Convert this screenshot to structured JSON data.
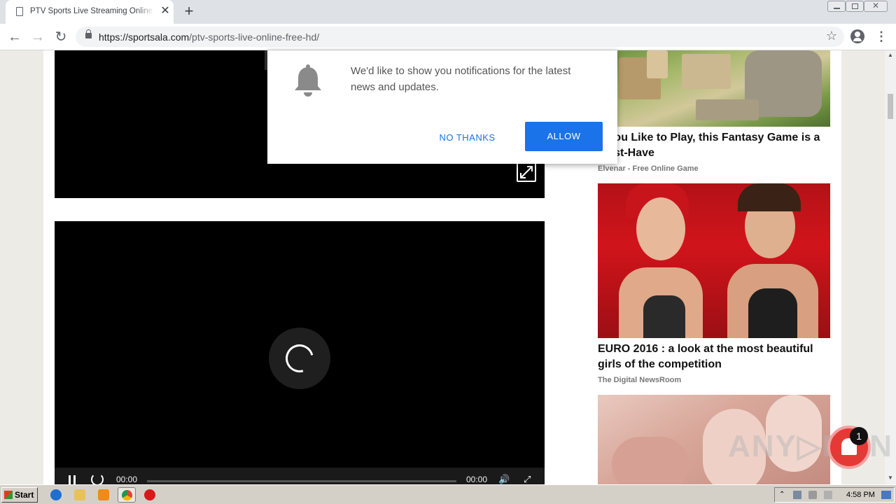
{
  "browser": {
    "tab_title": "PTV Sports Live Streaming Online *Free HD*",
    "url_host": "https://sportsala.com",
    "url_path": "/ptv-sports-live-online-free-hd/"
  },
  "notification_prompt": {
    "message": "We'd like to show you notifications for the latest news and updates.",
    "no_thanks_label": "NO THANKS",
    "allow_label": "ALLOW"
  },
  "player": {
    "time_current": "00:00",
    "time_total": "00:00"
  },
  "ads": [
    {
      "title": "If You Like to Play, this Fantasy Game is a Must-Have",
      "source": "Elvenar - Free Online Game"
    },
    {
      "title": "EURO 2016 : a look at the most beautiful girls of the competition",
      "source": "The Digital NewsRoom"
    }
  ],
  "watermark": {
    "text": "ANY.RUN",
    "badge_count": "1"
  },
  "taskbar": {
    "start_label": "Start",
    "clock": "4:58 PM"
  },
  "colors": {
    "accent": "#1a73e8",
    "page_bg": "#ecebe6",
    "taskbar": "#d4d0c8"
  }
}
